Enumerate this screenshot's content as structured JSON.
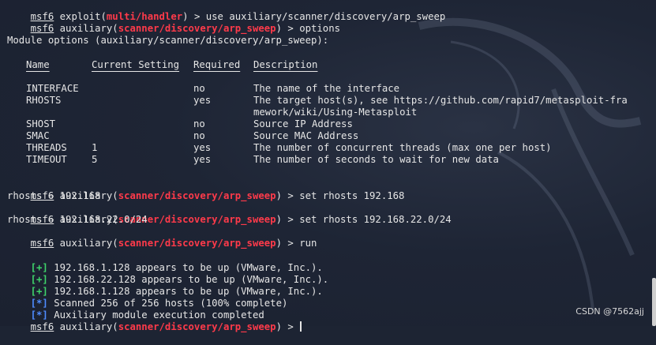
{
  "terminal": {
    "lines": {
      "l0": {
        "msf": "msf6",
        "pre": " exploit(",
        "mod": "multi/handler",
        "post": ") > use auxiliary/scanner/discovery/arp_sweep"
      },
      "l1": {
        "msf": "msf6",
        "pre": " auxiliary(",
        "mod": "scanner/discovery/arp_sweep",
        "post": ") > options"
      },
      "l2": {
        "text": "Module options (auxiliary/scanner/discovery/arp_sweep):"
      },
      "l8": {
        "msf": "msf6",
        "pre": " auxiliary(",
        "mod": "scanner/discovery/arp_sweep",
        "post": ") > set rhosts 192.168"
      },
      "l9": {
        "text": "rhosts ⇒ 192.168"
      },
      "l10": {
        "msf": "msf6",
        "pre": " auxiliary(",
        "mod": "scanner/discovery/arp_sweep",
        "post": ") > set rhosts 192.168.22.0/24"
      },
      "l11": {
        "text": "rhosts ⇒ 192.168.22.0/24"
      },
      "l12": {
        "msf": "msf6",
        "pre": " auxiliary(",
        "mod": "scanner/discovery/arp_sweep",
        "post": ") > run"
      },
      "r1": {
        "tag": "[+]",
        "text": " 192.168.1.128 appears to be up (VMware, Inc.)."
      },
      "r2": {
        "tag": "[+]",
        "text": " 192.168.22.128 appears to be up (VMware, Inc.)."
      },
      "r3": {
        "tag": "[+]",
        "text": " 192.168.1.128 appears to be up (VMware, Inc.)."
      },
      "r4": {
        "tag": "[*]",
        "text": " Scanned 256 of 256 hosts (100% complete)"
      },
      "r5": {
        "tag": "[*]",
        "text": " Auxiliary module execution completed"
      },
      "last": {
        "msf": "msf6",
        "pre": " auxiliary(",
        "mod": "scanner/discovery/arp_sweep",
        "post": ") > "
      }
    },
    "table": {
      "headers": {
        "name": "Name",
        "setting": "Current Setting",
        "required": "Required",
        "description": "Description"
      },
      "rows": [
        {
          "name": "INTERFACE",
          "setting": "",
          "required": "no",
          "description": "The name of the interface"
        },
        {
          "name": "RHOSTS",
          "setting": "",
          "required": "yes",
          "description": "The target host(s), see https://github.com/rapid7/metasploit-fra",
          "description2": "mework/wiki/Using-Metasploit"
        },
        {
          "name": "SHOST",
          "setting": "",
          "required": "no",
          "description": "Source IP Address"
        },
        {
          "name": "SMAC",
          "setting": "",
          "required": "no",
          "description": "Source MAC Address"
        },
        {
          "name": "THREADS",
          "setting": "1",
          "required": "yes",
          "description": "The number of concurrent threads (max one per host)"
        },
        {
          "name": "TIMEOUT",
          "setting": "5",
          "required": "yes",
          "description": "The number of seconds to wait for new data"
        }
      ]
    }
  },
  "watermark": "CSDN @7562ajj",
  "colors": {
    "background": "#1d2433",
    "prompt_module": "#ff3a4a",
    "info_tag": "#4f8cff",
    "success_tag": "#3fd36a"
  }
}
